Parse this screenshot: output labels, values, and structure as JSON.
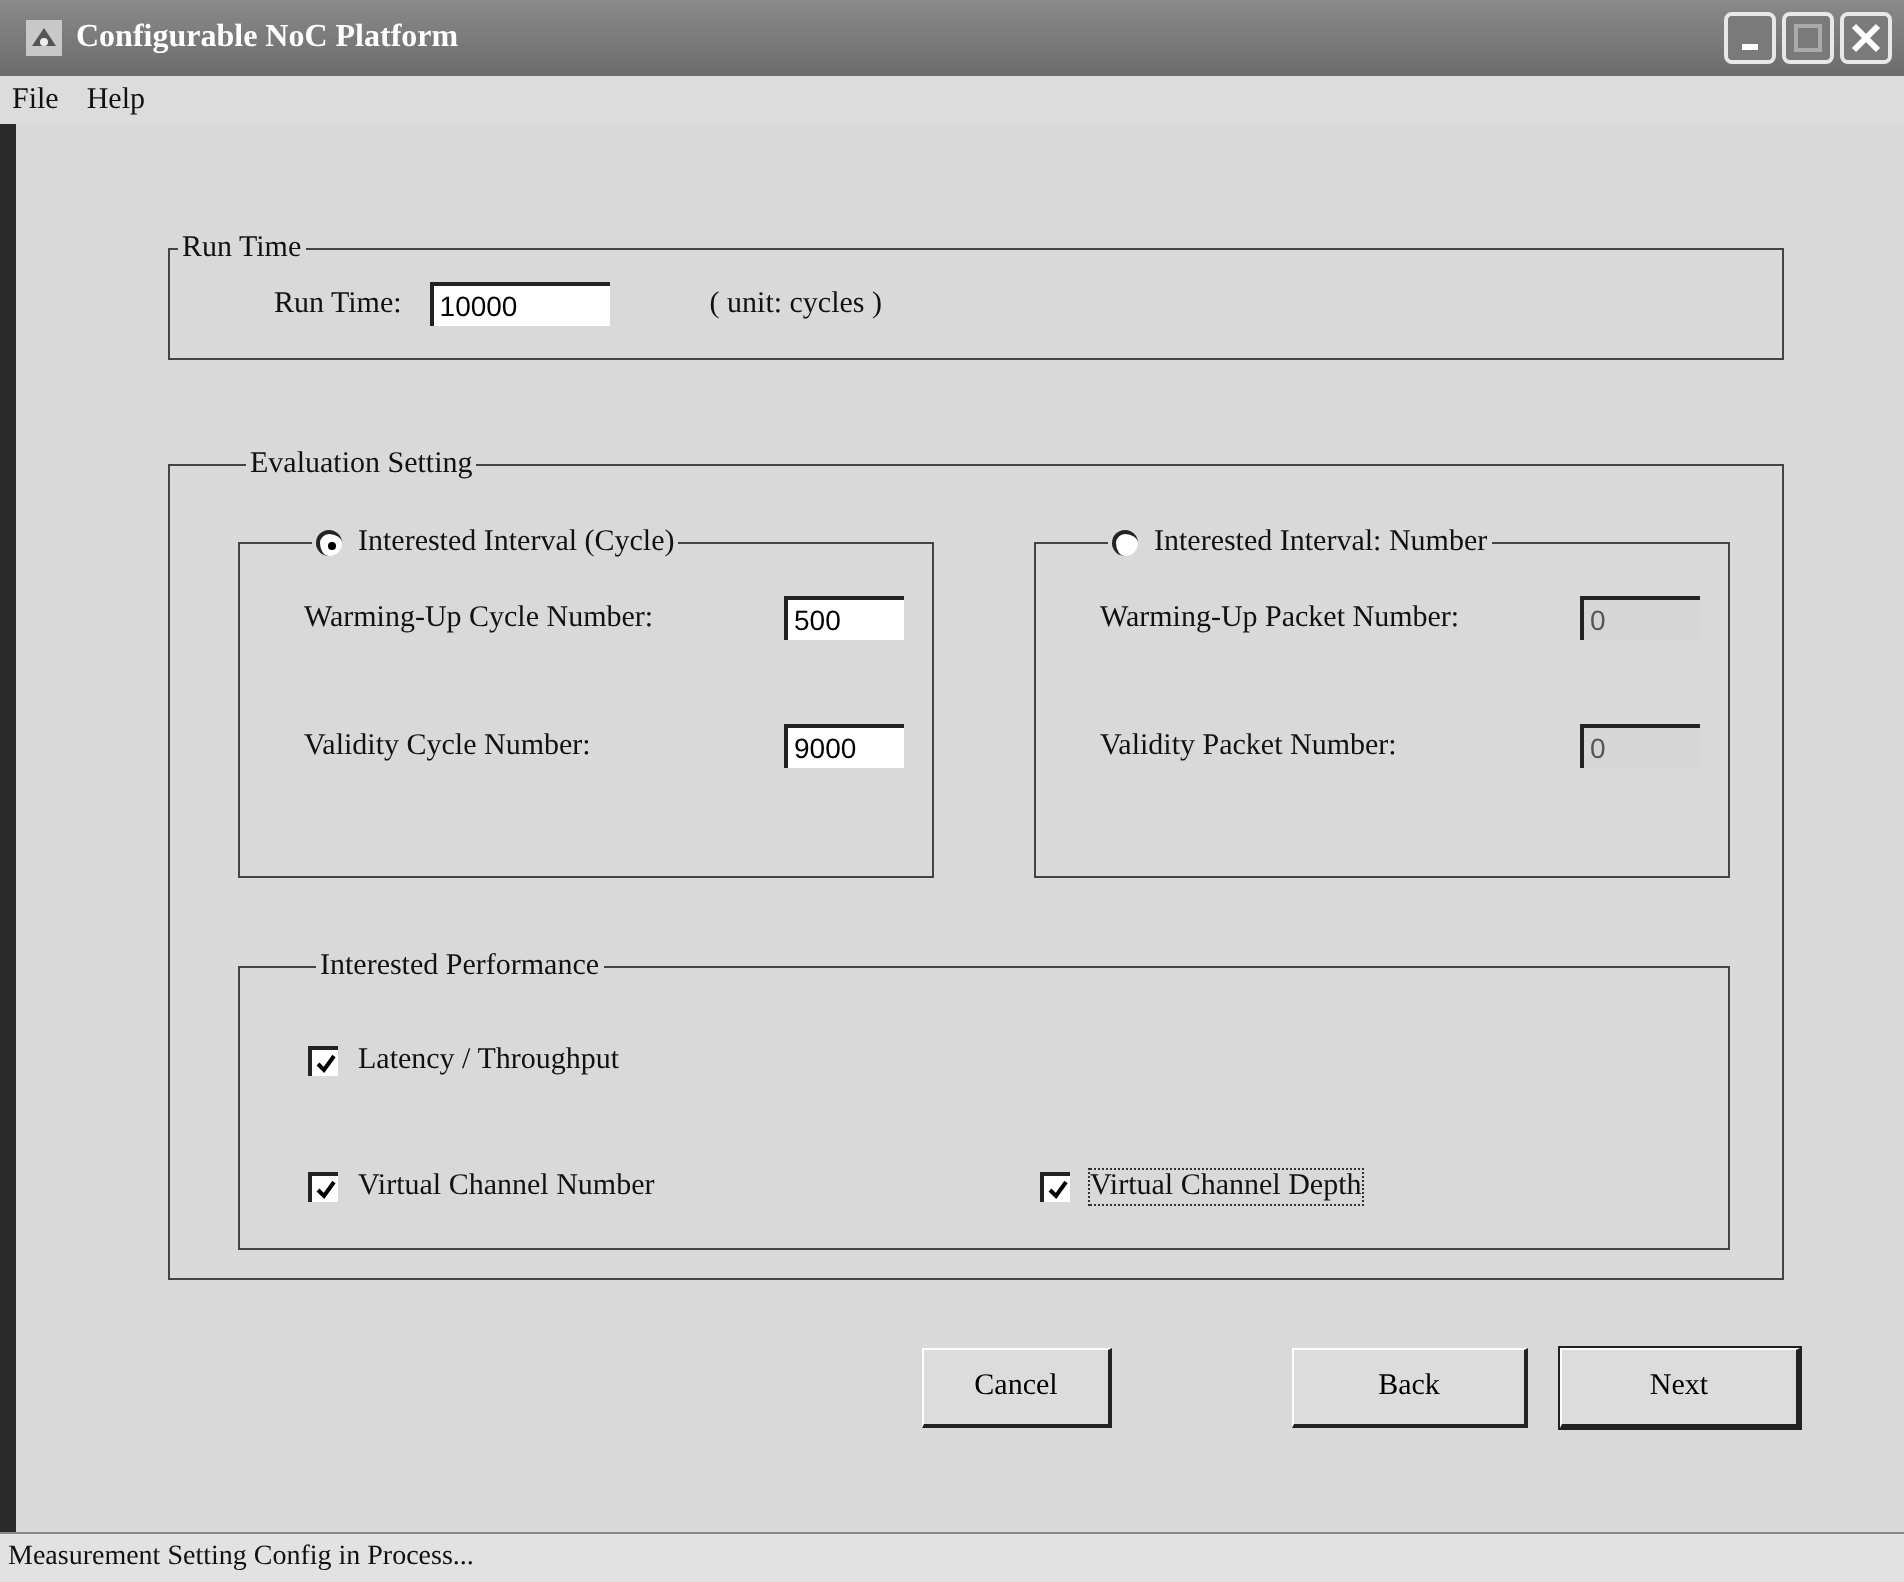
{
  "window": {
    "title": "Configurable NoC Platform"
  },
  "menu": [
    {
      "label": "File"
    },
    {
      "label": "Help"
    }
  ],
  "run_time": {
    "title": "Run Time",
    "label": "Run Time:",
    "value": "10000",
    "unit": "( unit: cycles )"
  },
  "evaluation": {
    "title": "Evaluation Setting",
    "intervals": [
      {
        "label": "Interested Interval (Cycle)",
        "selected": true,
        "fields": [
          {
            "label": "Warming-Up Cycle Number:",
            "value": "500",
            "disabled": false
          },
          {
            "label": "Validity Cycle Number:",
            "value": "9000",
            "disabled": false
          }
        ]
      },
      {
        "label": "Interested Interval: Number",
        "selected": false,
        "fields": [
          {
            "label": "Warming-Up Packet Number:",
            "value": "0",
            "disabled": true
          },
          {
            "label": "Validity Packet Number:",
            "value": "0",
            "disabled": true
          }
        ]
      }
    ],
    "performance": {
      "title": "Interested Performance",
      "options": [
        {
          "label": "Latency / Throughput",
          "checked": true,
          "focused": false
        },
        {
          "label": "Virtual Channel Number",
          "checked": true,
          "focused": false
        },
        {
          "label": "Virtual Channel Depth",
          "checked": true,
          "focused": true
        }
      ]
    }
  },
  "buttons": [
    {
      "label": "Cancel",
      "default": false
    },
    {
      "label": "Back",
      "default": false
    },
    {
      "label": "Next",
      "default": true
    }
  ],
  "status_bar": "Measurement Setting Config in Process..."
}
